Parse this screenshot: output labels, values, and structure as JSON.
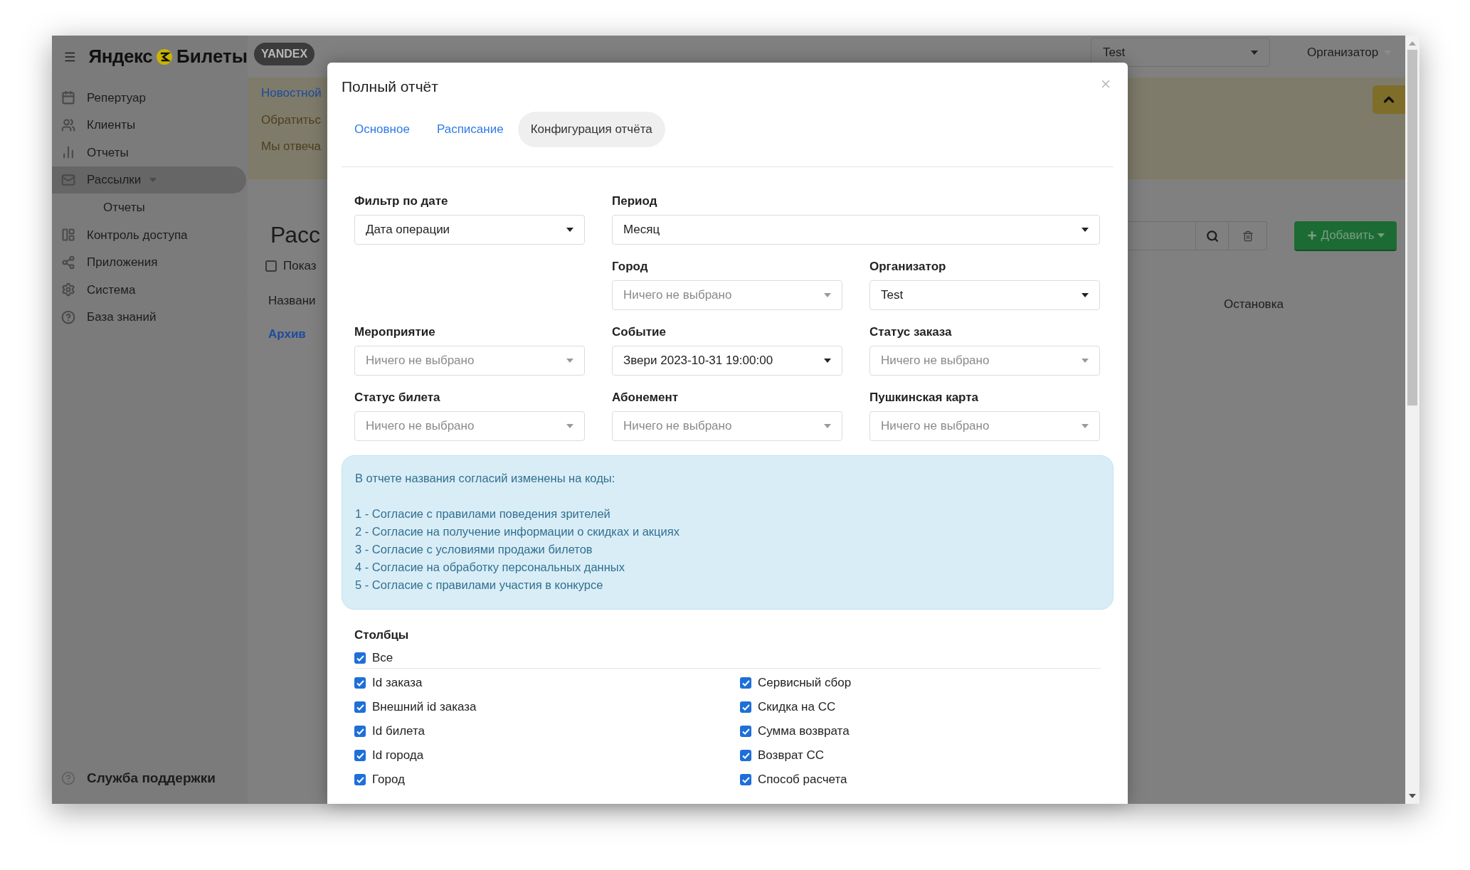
{
  "header": {
    "logo_left": "Яндекс",
    "logo_right": "Билеты",
    "badge": "YANDEX",
    "org_select": {
      "value": "Test"
    },
    "user_menu": "Организатор"
  },
  "sidebar": {
    "items": [
      {
        "label": "Репертуар",
        "selected": false
      },
      {
        "label": "Клиенты",
        "selected": false
      },
      {
        "label": "Отчеты",
        "selected": false
      },
      {
        "label": "Рассылки",
        "selected": true,
        "expanded": true,
        "children": [
          {
            "label": "Отчеты",
            "selected": false
          }
        ]
      },
      {
        "label": "Контроль доступа",
        "selected": false
      },
      {
        "label": "Приложения",
        "selected": false
      },
      {
        "label": "Система",
        "selected": false
      },
      {
        "label": "База знаний",
        "selected": false
      }
    ],
    "support": "Служба поддержки"
  },
  "banner": {
    "links": [
      {
        "label": "Новостной",
        "kind": "link"
      },
      {
        "label": "Обратитьс",
        "kind": "text"
      },
      {
        "label": "Мы отвеча",
        "kind": "text"
      }
    ]
  },
  "page": {
    "title": "Расс",
    "show_checkbox": {
      "label": "Показ",
      "checked": false
    },
    "column_header": "Названи",
    "archive_link": "Архив",
    "add_button": "Добавить",
    "right_column_header": "Остановка"
  },
  "modal": {
    "title": "Полный отчёт",
    "tabs": [
      {
        "label": "Основное",
        "selected": false
      },
      {
        "label": "Расписание",
        "selected": false
      },
      {
        "label": "Конфигурация отчёта",
        "selected": true
      }
    ],
    "filter_rows": [
      [
        {
          "label": "Фильтр по дате",
          "value": "Дата операции"
        },
        {
          "label": "Период",
          "value": "Месяц",
          "wide": true
        }
      ],
      [
        {
          "label": "Город",
          "placeholder": "Ничего не выбрано"
        },
        {
          "label": "Организатор",
          "value": "Test"
        }
      ],
      [
        {
          "label": "Мероприятие",
          "placeholder": "Ничего не выбрано"
        },
        {
          "label": "Событие",
          "value": "Звери 2023-10-31 19:00:00"
        },
        {
          "label": "Статус заказа",
          "placeholder": "Ничего не выбрано"
        }
      ],
      [
        {
          "label": "Статус билета",
          "placeholder": "Ничего не выбрано"
        },
        {
          "label": "Абонемент",
          "placeholder": "Ничего не выбрано"
        },
        {
          "label": "Пушкинская карта",
          "placeholder": "Ничего не выбрано"
        }
      ]
    ],
    "notice": {
      "heading": "В отчете названия согласий изменены на коды:",
      "lines": [
        "1 - Согласие с правилами поведения зрителей",
        "2 - Согласие на получение информации о скидках и акциях",
        "3 - Согласие с условиями продажи билетов",
        "4 - Согласие на обработку персональных данных",
        "5 - Согласие с правилами участия в конкурсе"
      ]
    },
    "columns": {
      "title": "Столбцы",
      "all": {
        "label": "Все",
        "checked": true
      },
      "items": [
        {
          "label": "Id заказа",
          "checked": true
        },
        {
          "label": "Сервисный сбор",
          "checked": true
        },
        {
          "label": "Внешний id заказа",
          "checked": true
        },
        {
          "label": "Скидка на СС",
          "checked": true
        },
        {
          "label": "Id билета",
          "checked": true
        },
        {
          "label": "Сумма возврата",
          "checked": true
        },
        {
          "label": "Id города",
          "checked": true
        },
        {
          "label": "Возврат СС",
          "checked": true
        },
        {
          "label": "Город",
          "checked": true
        },
        {
          "label": "Способ расчета",
          "checked": true
        }
      ]
    }
  }
}
